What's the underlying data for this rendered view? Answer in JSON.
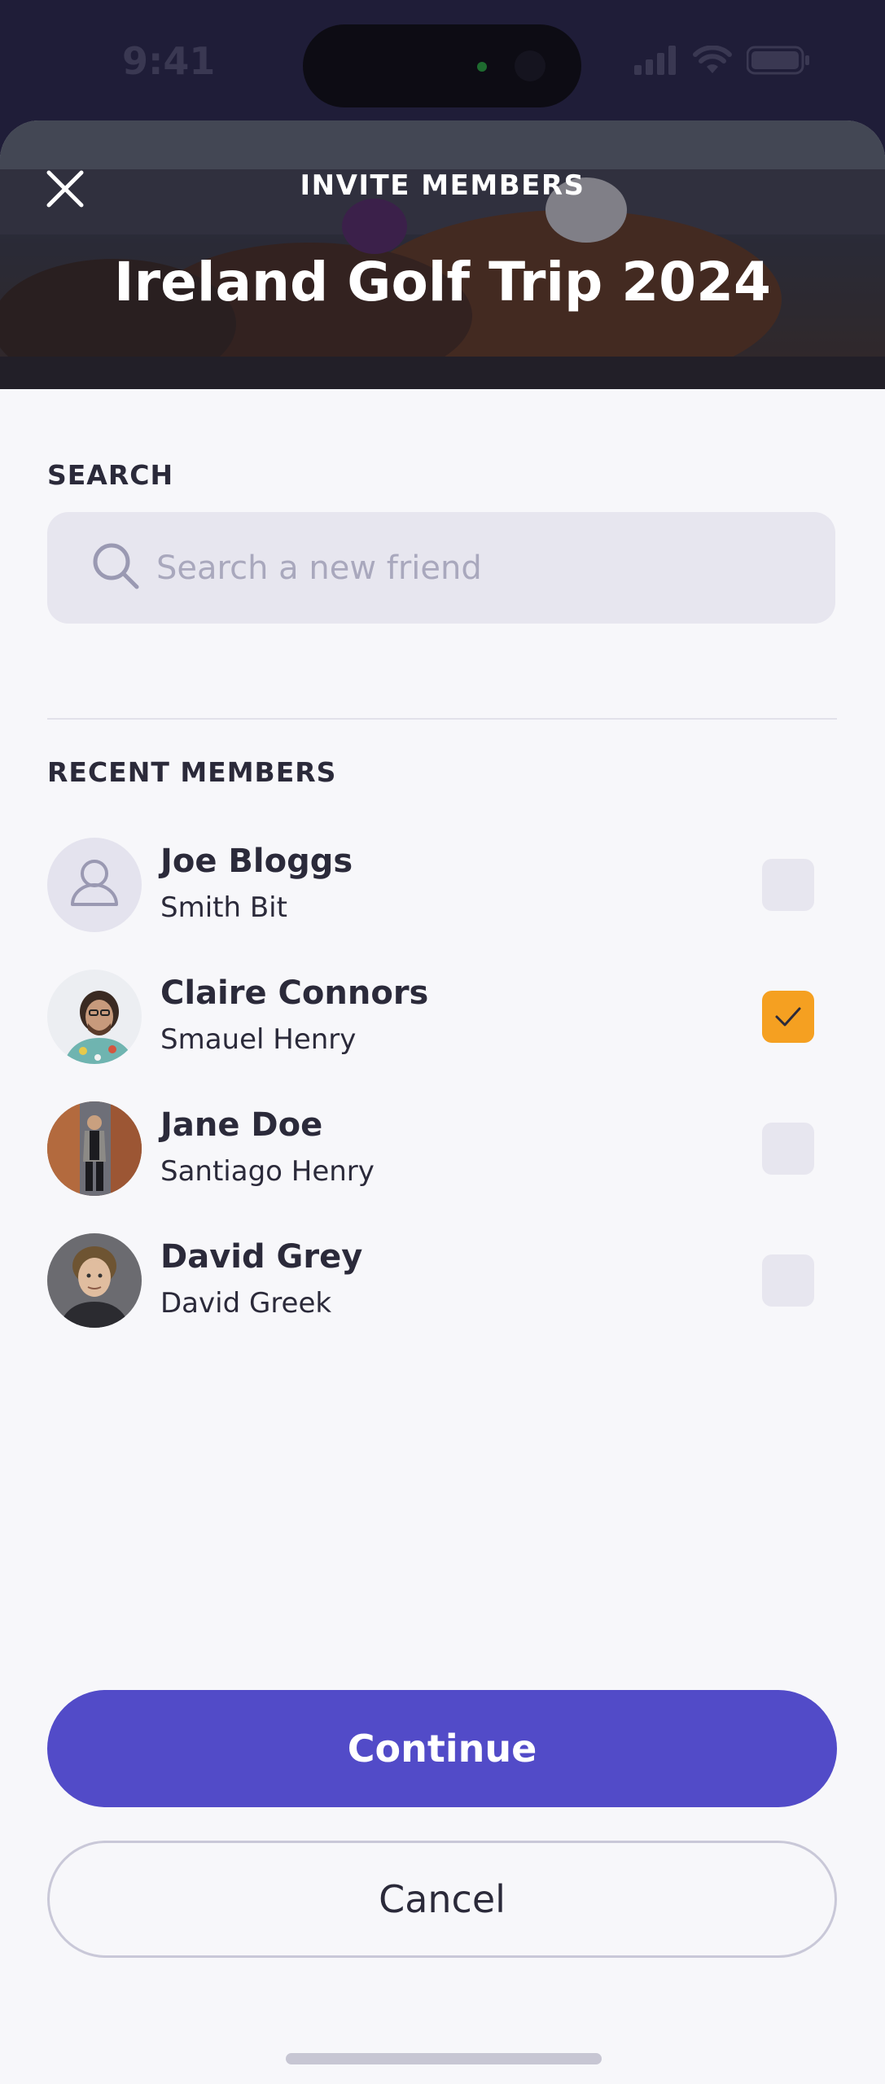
{
  "status_bar": {
    "time": "9:41"
  },
  "header": {
    "kicker": "INVITE MEMBERS",
    "title": "Ireland Golf Trip 2024"
  },
  "search": {
    "section_label": "SEARCH",
    "placeholder": "Search a new friend",
    "value": ""
  },
  "recent": {
    "section_label": "RECENT MEMBERS",
    "members": [
      {
        "name": "Joe Bloggs",
        "subtitle": "Smith Bit",
        "checked": false,
        "avatar": "placeholder-person-icon"
      },
      {
        "name": "Claire Connors",
        "subtitle": "Smauel Henry",
        "checked": true,
        "avatar": "photo"
      },
      {
        "name": "Jane Doe",
        "subtitle": "Santiago Henry",
        "checked": false,
        "avatar": "photo"
      },
      {
        "name": "David Grey",
        "subtitle": "David Greek",
        "checked": false,
        "avatar": "photo"
      }
    ]
  },
  "actions": {
    "continue_label": "Continue",
    "cancel_label": "Cancel"
  },
  "colors": {
    "primary": "#524bc8",
    "checked_accent": "#f5a021",
    "background": "#f7f7fa",
    "text": "#2b2a3a"
  }
}
